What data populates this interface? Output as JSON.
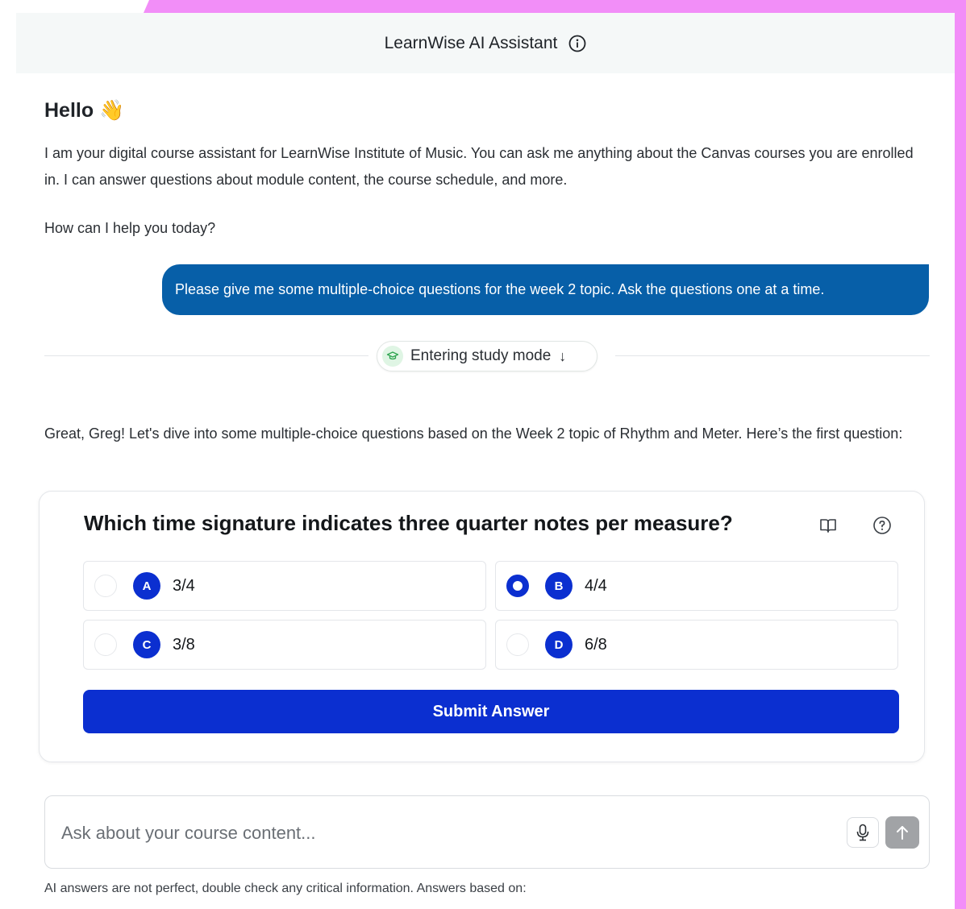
{
  "header": {
    "title": "LearnWise AI Assistant"
  },
  "chat": {
    "greeting": "Hello 👋",
    "intro": "I am your digital course assistant for LearnWise Institute of Music. You can ask me anything about the Canvas courses you are enrolled in. I can answer questions about module content, the course schedule, and more.",
    "help_prompt": "How can I help you today?",
    "user_message": "Please give me some multiple-choice questions for the week 2 topic. Ask the questions one at a time.",
    "study_mode_label": "Entering study mode",
    "assistant_reply": "Great, Greg! Let's dive into some multiple-choice questions based on the Week 2 topic of Rhythm and Meter. Here’s the first question:"
  },
  "quiz": {
    "question": "Which time signature indicates three quarter notes per measure?",
    "selected_option": "B",
    "options": [
      {
        "letter": "A",
        "text": "3/4"
      },
      {
        "letter": "B",
        "text": "4/4"
      },
      {
        "letter": "C",
        "text": "3/8"
      },
      {
        "letter": "D",
        "text": "6/8"
      }
    ],
    "submit_label": "Submit Answer"
  },
  "composer": {
    "placeholder": "Ask about your course content..."
  },
  "footer": {
    "disclaimer": "AI answers are not perfect, double check any critical information. Answers based on:"
  },
  "colors": {
    "frame": "#f28ef8",
    "user_bubble": "#075fa8",
    "accent": "#0b2fd0",
    "send_disabled": "#a1a3a6"
  }
}
